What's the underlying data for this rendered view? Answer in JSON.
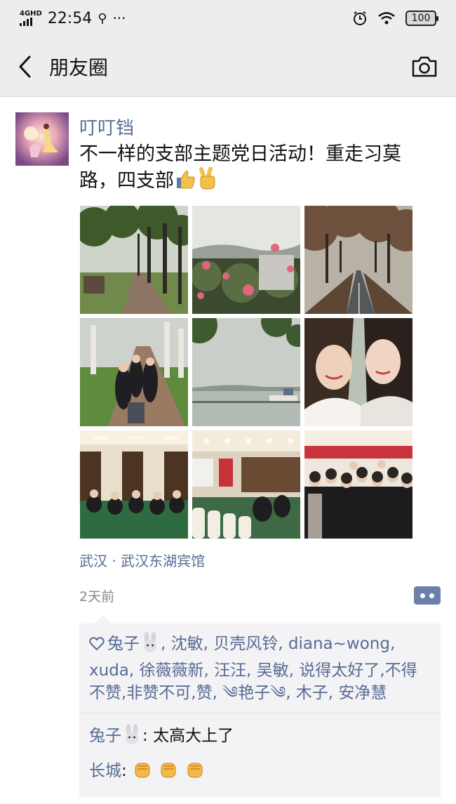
{
  "status_bar": {
    "network": "4GHD",
    "time": "22:54",
    "battery": "100"
  },
  "nav": {
    "title": "朋友圈"
  },
  "post": {
    "author": "叮叮铛",
    "text_line1": "不一样的支部主题党日活动！重走习莫",
    "text_line2": "路，四支部",
    "location": "武汉 · 武汉东湖宾馆",
    "time_ago": "2天前"
  },
  "photos": [
    {
      "name": "photo-tree-lined-path"
    },
    {
      "name": "photo-pink-flowers"
    },
    {
      "name": "photo-tree-road"
    },
    {
      "name": "photo-group-walkway"
    },
    {
      "name": "photo-lake-view"
    },
    {
      "name": "photo-two-women-selfie"
    },
    {
      "name": "photo-meeting-room"
    },
    {
      "name": "photo-conference-hall"
    },
    {
      "name": "photo-group-portrait"
    }
  ],
  "likes": {
    "part1": "兔子",
    "part2": ", 沈敏, 贝壳风铃, diana~wong, xuda, 徐薇薇新, 汪汪, 吴敏, 说得太好了,不得不赞,非赞不可,赞, ",
    "part3": "༄艳子༄",
    "part4": ", 木子, 安净慧"
  },
  "comments": [
    {
      "user": "兔子",
      "separator": ": ",
      "text": "太高大上了",
      "emoji": "rabbit"
    },
    {
      "user": "长城",
      "separator": ": ",
      "text": "",
      "emoji": "fists"
    }
  ],
  "colors": {
    "link": "#576b95",
    "bar_bg": "#ededed",
    "comment_bg": "#f3f3f5"
  },
  "icons": [
    "back-arrow-icon",
    "camera-icon",
    "heart-icon",
    "more-dots-icon",
    "rabbit-emoji",
    "raised-fist-emoji",
    "thumbs-up-emoji",
    "victory-hand-emoji"
  ]
}
